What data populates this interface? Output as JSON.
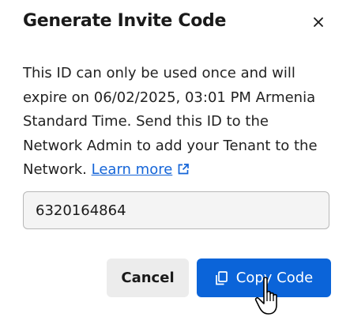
{
  "dialog": {
    "title": "Generate Invite Code",
    "close_icon": "close-icon",
    "message": "This ID can only be used once and will expire on 06/02/2025, 03:01 PM Armenia Standard Time. Send this ID to the Network Admin to add your Tenant to the Network.",
    "learn_more_label": "Learn more",
    "learn_more_icon": "external-link-icon",
    "code_value": "6320164864",
    "cancel_label": "Cancel",
    "copy_label": "Copy Code",
    "copy_icon": "copy-icon"
  },
  "colors": {
    "primary": "#0b64d9",
    "link": "#1565d8",
    "secondary_button": "#ececec",
    "field_background": "#f4f4f4"
  }
}
